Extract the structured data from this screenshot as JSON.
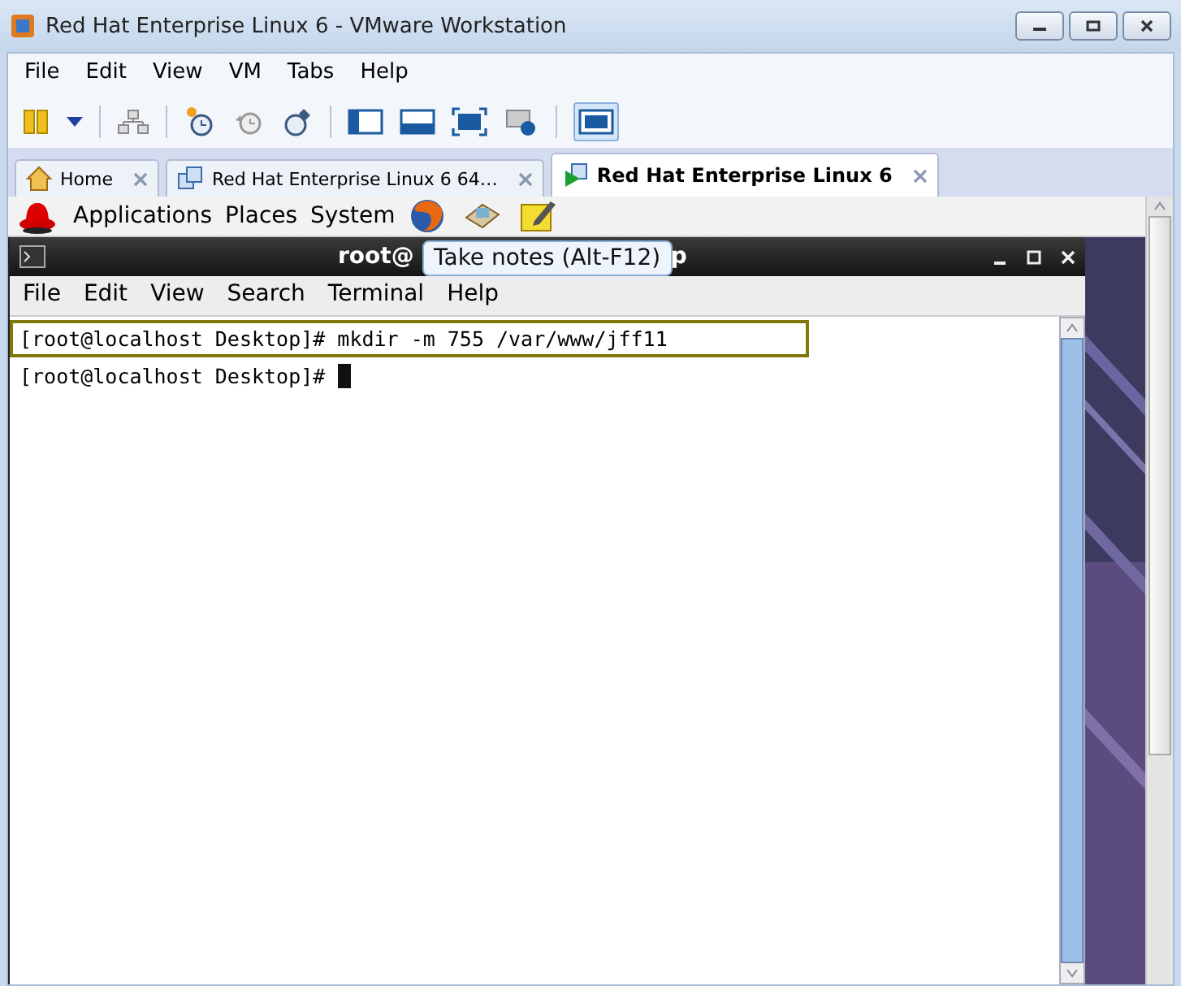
{
  "window": {
    "title": "Red Hat Enterprise Linux 6 - VMware Workstation"
  },
  "menu": [
    "File",
    "Edit",
    "View",
    "VM",
    "Tabs",
    "Help"
  ],
  "tabs": [
    {
      "label": "Home",
      "kind": "home",
      "selected": false
    },
    {
      "label": "Red Hat Enterprise Linux 6 64…",
      "kind": "vm",
      "selected": false
    },
    {
      "label": "Red Hat Enterprise Linux 6",
      "kind": "vm-running",
      "selected": true
    }
  ],
  "guest_panel": {
    "menus": [
      "Applications",
      "Places",
      "System"
    ]
  },
  "terminal": {
    "title_parts": [
      "root@",
      "p"
    ],
    "menu": [
      "File",
      "Edit",
      "View",
      "Search",
      "Terminal",
      "Help"
    ],
    "lines": [
      {
        "text": "[root@localhost Desktop]# mkdir -m 755 /var/www/jff11",
        "highlighted": true,
        "cursor": false
      },
      {
        "text": "[root@localhost Desktop]# ",
        "highlighted": false,
        "cursor": true
      }
    ]
  },
  "tooltip": "Take notes (Alt-F12)"
}
